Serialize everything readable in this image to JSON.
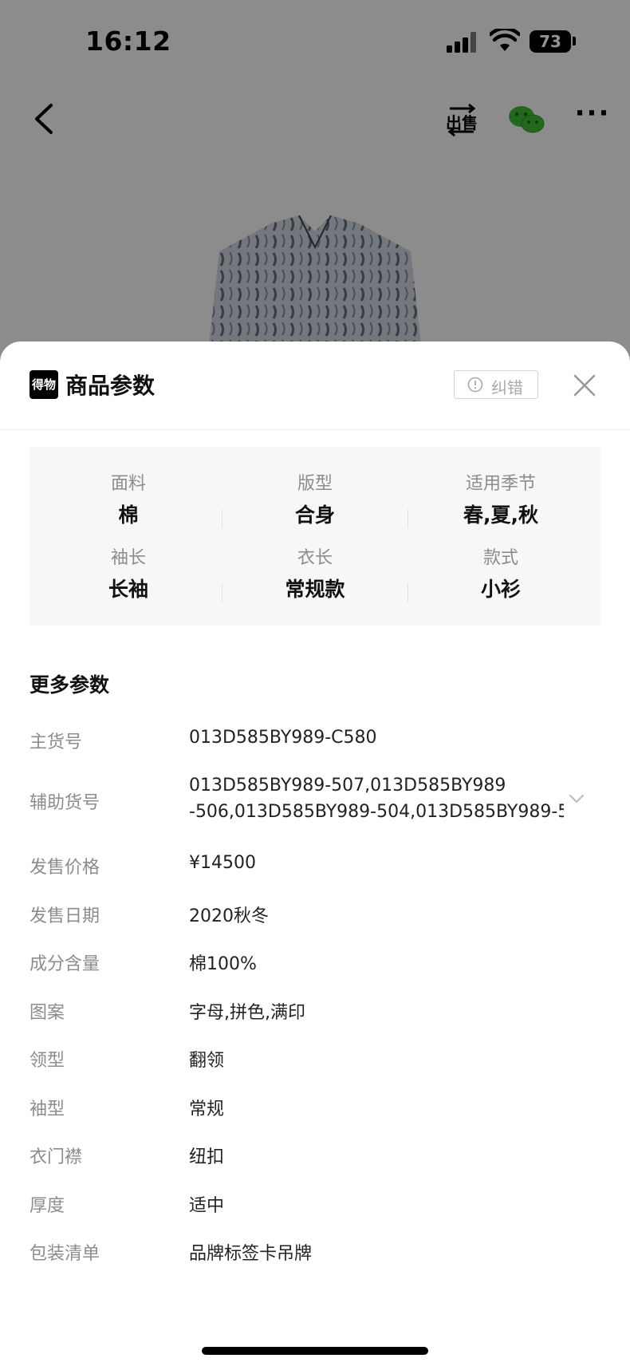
{
  "status_bar": {
    "time": "16:12",
    "battery": "73"
  },
  "top_nav": {
    "sell_label": "出售"
  },
  "sheet": {
    "logo_text": "得物",
    "title": "商品参数",
    "report_label": "纠错",
    "specs": [
      {
        "label": "面料",
        "value": "棉"
      },
      {
        "label": "版型",
        "value": "合身"
      },
      {
        "label": "适用季节",
        "value": "春,夏,秋"
      },
      {
        "label": "袖长",
        "value": "长袖"
      },
      {
        "label": "衣长",
        "value": "常规款"
      },
      {
        "label": "款式",
        "value": "小衫"
      }
    ],
    "more_title": "更多参数",
    "params": [
      {
        "label": "主货号",
        "value": "013D585BY989-C580"
      },
      {
        "label": "辅助货号",
        "value": "013D585BY989-507,013D585BY989\n-506,013D585BY989-504,013D585BY989-5"
      },
      {
        "label": "发售价格",
        "value": "¥14500"
      },
      {
        "label": "发售日期",
        "value": "2020秋冬"
      },
      {
        "label": "成分含量",
        "value": "棉100%"
      },
      {
        "label": "图案",
        "value": "字母,拼色,满印"
      },
      {
        "label": "领型",
        "value": "翻领"
      },
      {
        "label": "袖型",
        "value": "常规"
      },
      {
        "label": "衣门襟",
        "value": "纽扣"
      },
      {
        "label": "厚度",
        "value": "适中"
      },
      {
        "label": "包装清单",
        "value": "品牌标签卡吊牌"
      }
    ]
  }
}
